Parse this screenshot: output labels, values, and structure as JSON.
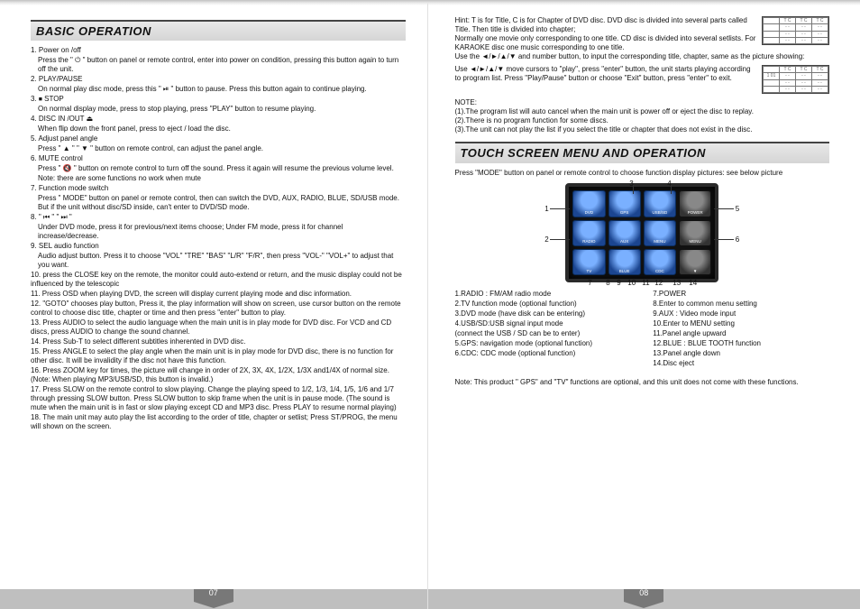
{
  "left": {
    "heading": "BASIC OPERATION",
    "items": [
      "1. Power on /off",
      "   Press the \" ⏻ \" button on panel or remote control, enter into power on condition, pressing this button again to turn off the unit.",
      "2. PLAY/PAUSE",
      "   On normal play disc mode, press this \" ⏯ \" button to pause. Press this button again to continue playing.",
      "3. ⏹ STOP",
      "   On normal display mode, press to stop playing, press \"PLAY\" button to resume playing.",
      "4. DISC IN /OUT ⏏",
      "   When flip down the front panel, press to eject / load the disc.",
      "5. Adjust panel angle",
      "   Press \" ▲ \" \" ▼ \" button on remote control, can adjust the panel angle.",
      "6. MUTE control",
      "   Press \" 🔇 \" button on remote control to turn off the sound. Press it again will resume the previous volume level.",
      "   Note: there are some functions no work when mute",
      "7. Function mode switch",
      "   Press \" MODE\" button on panel or remote control, then can switch the DVD, AUX, RADIO, BLUE, SD/USB mode. But if the unit without disc/SD inside, can't enter to DVD/SD mode.",
      "8. \" ⏮ \" \" ⏭ \"",
      "   Under DVD mode, press it for previous/next items choose; Under FM mode, press it for channel increase/decrease.",
      "9. SEL audio function",
      "   Audio adjust button. Press it to choose \"VOL\" \"TRE\" \"BAS\" \"L/R\" \"F/R\", then press \"VOL-\" \"VOL+\" to adjust that you want.",
      "10. press the CLOSE key on the remote, the monitor could auto-extend or return, and the music display could not be influenced by the telescopic",
      "11. Press OSD when playing DVD, the screen will display current playing mode and disc information.",
      "12. \"GOTO\" chooses play button, Press it, the play information will show on screen, use cursor button on the remote control to choose disc title, chapter or time and then press \"enter\" button to play.",
      "13. Press AUDIO to select the audio language when the main unit is in play mode for DVD disc. For VCD and CD discs, press AUDIO to change the sound channel.",
      "14. Press Sub-T to select different subtitles inherented in DVD disc.",
      "15. Press ANGLE to select the play angle when the main unit is in play mode for DVD disc, there is no function for other disc. It will be invalidity if the disc not have this function.",
      "16. Press ZOOM key for times, the picture will change in order of 2X, 3X, 4X, 1/2X, 1/3X and1/4X of normal size. (Note: When playing MP3/USB/SD, this button is invalid.)",
      "17. Press SLOW on the remote control to slow playing. Change the playing speed to 1/2, 1/3, 1/4, 1/5, 1/6 and 1/7 through pressing SLOW button. Press SLOW button to skip frame when the unit is in pause mode. (The sound is mute when the main unit is in fast or slow playing except CD and MP3 disc. Press PLAY to resume normal playing)",
      "18. The main unit may auto play the list according to the order of title, chapter or setlist; Press ST/PROG, the menu will shown on the screen."
    ],
    "pagenum": "07"
  },
  "right": {
    "intro": [
      "Hint: T is for Title, C is for Chapter of DVD disc. DVD disc is divided into several parts called Title. Then title is divided into chapter;",
      "Normally one movie only corresponding to one title. CD disc is divided into several setlists. For KARAOKE disc one music corresponding to one title.",
      "Use the ◄/►/▲/▼ and number button, to input the corresponding title, chapter, same as the picture showing:"
    ],
    "intro2": [
      "Use ◄/►/▲/▼ move cursors to \"play\", press \"enter\" button, the unit starts playing according to program list. Press \"Play/Pause\" button or choose \"Exit\" button, press \"enter\" to exit."
    ],
    "note_label": "NOTE:",
    "notes": [
      "(1).The program list will auto cancel when the main unit is power off or eject the disc to replay.",
      "(2).There is no program function for some discs.",
      "(3).The unit can not play the list if you select the title or chapter that does not exist in the disc."
    ],
    "heading": "TOUCH SCREEN MENU AND OPERATION",
    "touch_intro": "Press \"MODE\" button on panel or remote control to choose function display pictures: see below picture",
    "apps": [
      "DVD",
      "GPS",
      "USB/SD",
      "POWER",
      "RADIO",
      "AUX",
      "MENU",
      "MENU",
      "TV",
      "BLUE",
      "CDC",
      "▼"
    ],
    "callouts": {
      "c1": "1",
      "c2": "2",
      "c3": "3",
      "c4": "4",
      "c5": "5",
      "c6": "6",
      "c7": "7",
      "c8": "8",
      "c9": "9",
      "c10": "10",
      "c11": "11",
      "c12": "12",
      "c13": "13",
      "c14": "14"
    },
    "legend_left": [
      "1.RADIO : FM/AM radio mode",
      "2.TV function mode (optional function)",
      "3.DVD mode (have disk can be entering)",
      "4.USB/SD:USB signal input mode",
      "  (connect the USB / SD can be to enter)",
      "5.GPS: navigation mode (optional function)",
      "6.CDC: CDC mode (optional function)"
    ],
    "legend_right": [
      "7.POWER",
      "8.Enter to common menu setting",
      "9.AUX : Video mode input",
      "10.Enter to MENU setting",
      "11.Panel angle upward",
      "12.BLUE : BLUE TOOTH function",
      "13.Panel angle down",
      "14.Disc eject"
    ],
    "footnote": "Note: This product \" GPS\" and \"TV\" functions are optional, and this unit does not come with these functions.",
    "pagenum": "08"
  }
}
